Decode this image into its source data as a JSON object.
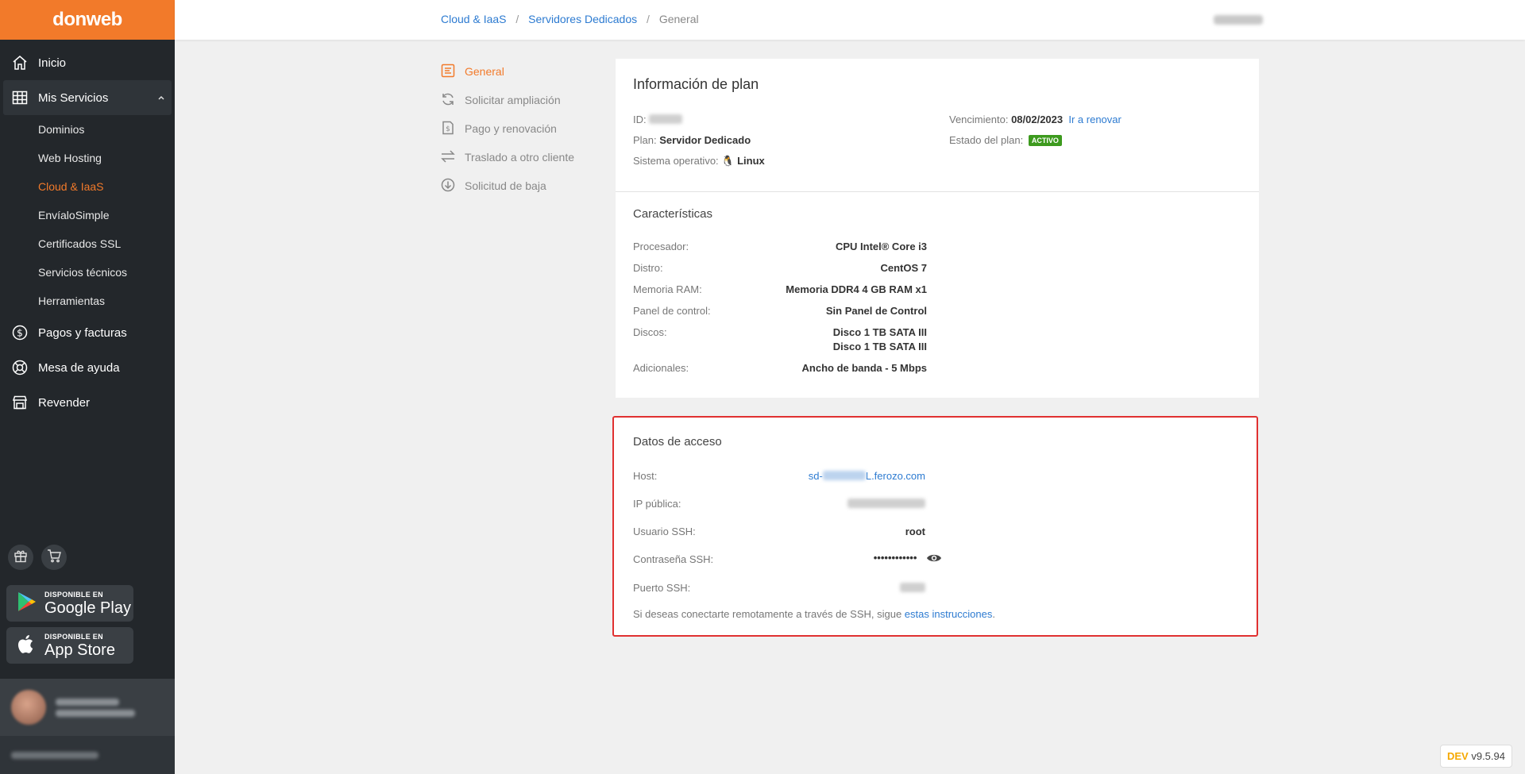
{
  "brand": {
    "logo": "donweb",
    "accent": "#f27a2a"
  },
  "sidebar": {
    "items": [
      {
        "label": "Inicio",
        "icon": "home-icon"
      },
      {
        "label": "Mis Servicios",
        "icon": "grid-icon"
      },
      {
        "label": "Pagos y facturas",
        "icon": "dollar-circle-icon"
      },
      {
        "label": "Mesa de ayuda",
        "icon": "lifebuoy-icon"
      },
      {
        "label": "Revender",
        "icon": "store-icon"
      }
    ],
    "sub_items": [
      "Dominios",
      "Web Hosting",
      "Cloud & IaaS",
      "EnvíaloSimple",
      "Certificados SSL",
      "Servicios técnicos",
      "Herramientas"
    ],
    "google_play": {
      "small": "DISPONIBLE EN",
      "big": "Google Play"
    },
    "app_store": {
      "small": "DISPONIBLE EN",
      "big": "App Store"
    }
  },
  "breadcrumb": {
    "level1": "Cloud & IaaS",
    "level2": "Servidores Dedicados",
    "current": "General"
  },
  "submenu": [
    "General",
    "Solicitar ampliación",
    "Pago y renovación",
    "Traslado a otro cliente",
    "Solicitud de baja"
  ],
  "plan": {
    "title": "Información de plan",
    "id_label": "ID:",
    "plan_label": "Plan:",
    "plan_value": "Servidor Dedicado",
    "os_label": "Sistema operativo:",
    "os_value": "Linux",
    "expiry_label": "Vencimiento:",
    "expiry_value": "08/02/2023",
    "renew_link": "Ir a renovar",
    "status_label": "Estado del plan:",
    "status_value": "ACTIVO"
  },
  "features": {
    "title": "Características",
    "rows": [
      {
        "label": "Procesador:",
        "value": "CPU Intel® Core i3"
      },
      {
        "label": "Distro:",
        "value": "CentOS 7"
      },
      {
        "label": "Memoria RAM:",
        "value": "Memoria DDR4 4 GB RAM x1"
      },
      {
        "label": "Panel de control:",
        "value": "Sin Panel de Control"
      },
      {
        "label": "Discos:",
        "value": "Disco 1 TB SATA III",
        "value2": "Disco 1 TB SATA III"
      },
      {
        "label": "Adicionales:",
        "value": "Ancho de banda - 5 Mbps"
      }
    ]
  },
  "access": {
    "title": "Datos de acceso",
    "host_label": "Host:",
    "host_prefix": "sd-",
    "host_suffix": "L.ferozo.com",
    "ip_label": "IP pública:",
    "user_label": "Usuario SSH:",
    "user_value": "root",
    "password_label": "Contraseña SSH:",
    "password_value": "••••••••••••",
    "port_label": "Puerto SSH:",
    "note_text": "Si deseas conectarte remotamente a través de SSH, sigue ",
    "note_link": "estas instrucciones",
    "note_end": "."
  },
  "version": {
    "env": "DEV",
    "number": "v9.5.94"
  }
}
